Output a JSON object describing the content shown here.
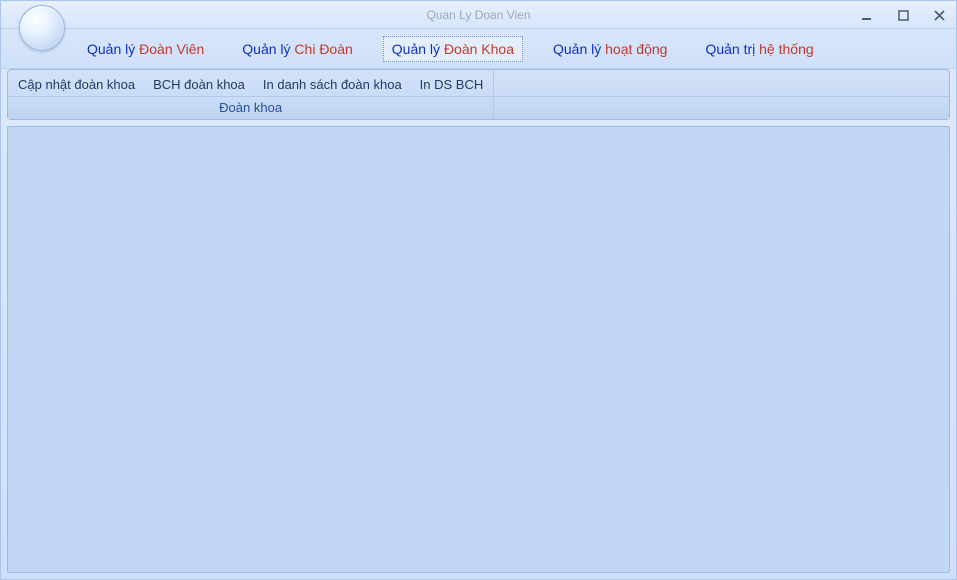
{
  "window": {
    "title": "Quan Ly Doan Vien"
  },
  "menubar": {
    "items": [
      {
        "p1": "Quản lý ",
        "p2": "Đoàn Viên"
      },
      {
        "p1": "Quản lý ",
        "p2": "Chi Đoàn"
      },
      {
        "p1": "Quản lý ",
        "p2": "Đoàn Khoa"
      },
      {
        "p1": "Quản lý ",
        "p2": "hoạt động"
      },
      {
        "p1": "Quản trị ",
        "p2": "hệ thống"
      }
    ],
    "active_index": 2
  },
  "ribbon": {
    "groups": [
      {
        "label": "Đoàn khoa",
        "items": [
          "Cập nhật đoàn khoa",
          "BCH đoàn khoa",
          "In danh sách đoàn khoa",
          "In DS BCH"
        ]
      }
    ]
  }
}
